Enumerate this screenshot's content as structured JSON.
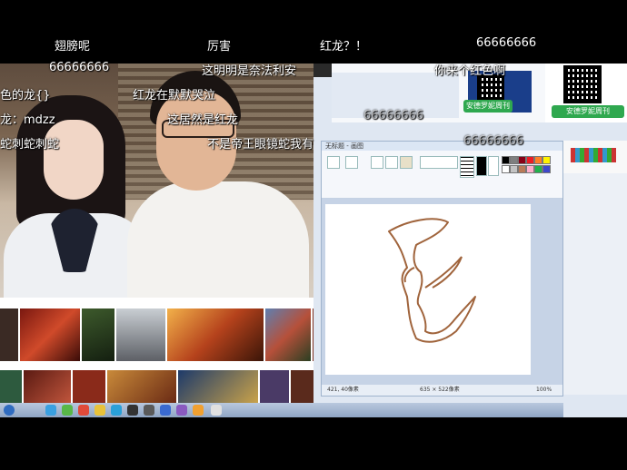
{
  "danmaku_top": [
    {
      "text": "翅膀呢"
    },
    {
      "text": "厉害"
    },
    {
      "text": "红龙？！"
    },
    {
      "text": "66666666"
    }
  ],
  "danmaku_overlay": [
    {
      "text": "66666666"
    },
    {
      "text": "这明明是奈法利安"
    },
    {
      "text": "你来个红色啊"
    },
    {
      "text": "色的龙{}"
    },
    {
      "text": "红龙在默默哭泣"
    },
    {
      "text": "龙：mdzz"
    },
    {
      "text": "这居然是红龙"
    },
    {
      "text": "蛇刺蛇刺蛇"
    },
    {
      "text": "不是帝王眼镜蛇我有"
    },
    {
      "text": "66666666"
    },
    {
      "text": "66666666"
    }
  ],
  "desktop": {
    "promo_button_1": "安德罗妮周刊",
    "promo_button_2": "安德罗妮周刊",
    "paint_window_title": "无标题 - 画图",
    "status_left": "421, 40像素",
    "status_mid": "635 × 522像素",
    "zoom": "100%"
  },
  "colors": {
    "drawing_stroke": "#a0643c",
    "promo_green": "#2fa84f"
  }
}
